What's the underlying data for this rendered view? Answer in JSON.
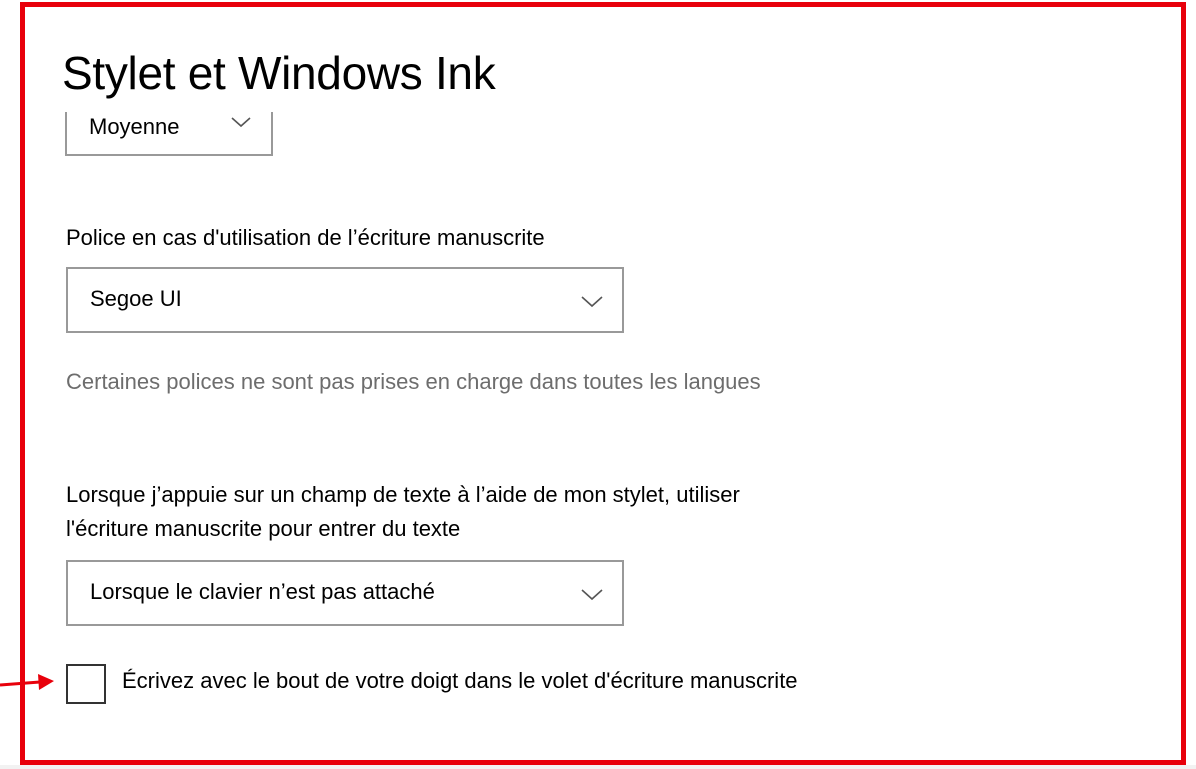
{
  "page": {
    "title": "Stylet et Windows Ink"
  },
  "partial_dropdown": {
    "value": "Moyenne"
  },
  "font_section": {
    "label": "Police en cas d'utilisation de l’écriture manuscrite",
    "selected": "Segoe UI",
    "hint": "Certaines polices ne sont pas prises en charge dans toutes les langues"
  },
  "handwriting_section": {
    "label_line1": "Lorsque j’appuie sur un champ de texte à l’aide de mon stylet, utiliser",
    "label_line2": "l'écriture manuscrite pour entrer du texte",
    "selected": "Lorsque le clavier n’est pas attaché"
  },
  "finger_checkbox": {
    "checked": false,
    "label": "Écrivez avec le bout de votre doigt dans le volet d'écriture manuscrite"
  },
  "colors": {
    "highlight_border": "#e8000b",
    "annotation_arrow": "#e8000b",
    "hint_text": "#6d6d6d",
    "dropdown_border": "#999999"
  },
  "icons": {
    "dropdown_chevron": "chevron-down-icon",
    "annotation": "arrow-right-icon"
  }
}
